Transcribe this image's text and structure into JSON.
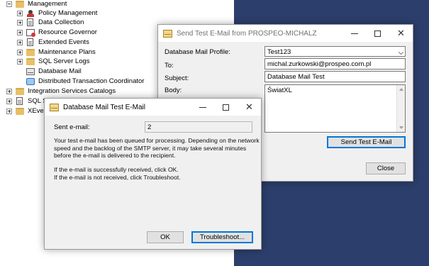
{
  "tree": {
    "items": [
      {
        "label": "Management",
        "expander": "minus",
        "icon": "folder-icon"
      },
      {
        "label": "Policy Management",
        "expander": "plus",
        "icon": "policy-icon"
      },
      {
        "label": "Data Collection",
        "expander": "plus",
        "icon": "doc-icon"
      },
      {
        "label": "Resource Governor",
        "expander": "plus",
        "icon": "resource-governor-icon"
      },
      {
        "label": "Extended Events",
        "expander": "plus",
        "icon": "doc-icon"
      },
      {
        "label": "Maintenance Plans",
        "expander": "plus",
        "icon": "folder-icon"
      },
      {
        "label": "SQL Server Logs",
        "expander": "plus",
        "icon": "folder-icon"
      },
      {
        "label": "Database Mail",
        "expander": "none",
        "icon": "mail-icon"
      },
      {
        "label": "Distributed Transaction Coordinator",
        "expander": "none",
        "icon": "dtc-icon"
      },
      {
        "label": "Integration Services Catalogs",
        "expander": "plus",
        "icon": "folder-icon"
      },
      {
        "label": "SQL Se",
        "expander": "plus",
        "icon": "doc-icon"
      },
      {
        "label": "XEvent",
        "expander": "plus",
        "icon": "folder-icon"
      }
    ]
  },
  "send_dialog": {
    "title": "Send Test E-Mail from PROSPEO-MICHALZ",
    "profile_label": "Database Mail Profile:",
    "profile_value": "Test123",
    "to_label": "To:",
    "to_value": "michal.zurkowski@prospeo.com.pl",
    "subject_label": "Subject:",
    "subject_value": "Database Mail Test",
    "body_label": "Body:",
    "body_value": "ŚwiatXL",
    "send_button": "Send Test E-Mail",
    "close_button": "Close"
  },
  "test_dialog": {
    "title": "Database Mail Test E-Mail",
    "sent_label": "Sent e-mail:",
    "sent_value": "2",
    "message_lines": [
      "Your test e-mail has been queued for processing.  Depending on the network",
      "speed and the backlog of the SMTP server, it may take several minutes",
      "before the e-mail is delivered to the recipient."
    ],
    "instruction_lines": [
      "If the e-mail is successfully received, click OK.",
      "If the e-mail is not received, click Troubleshoot."
    ],
    "ok_button": "OK",
    "troubleshoot_button": "Troubleshoot..."
  },
  "colors": {
    "desktop": "#2c3e6b",
    "accent": "#0078d7"
  }
}
